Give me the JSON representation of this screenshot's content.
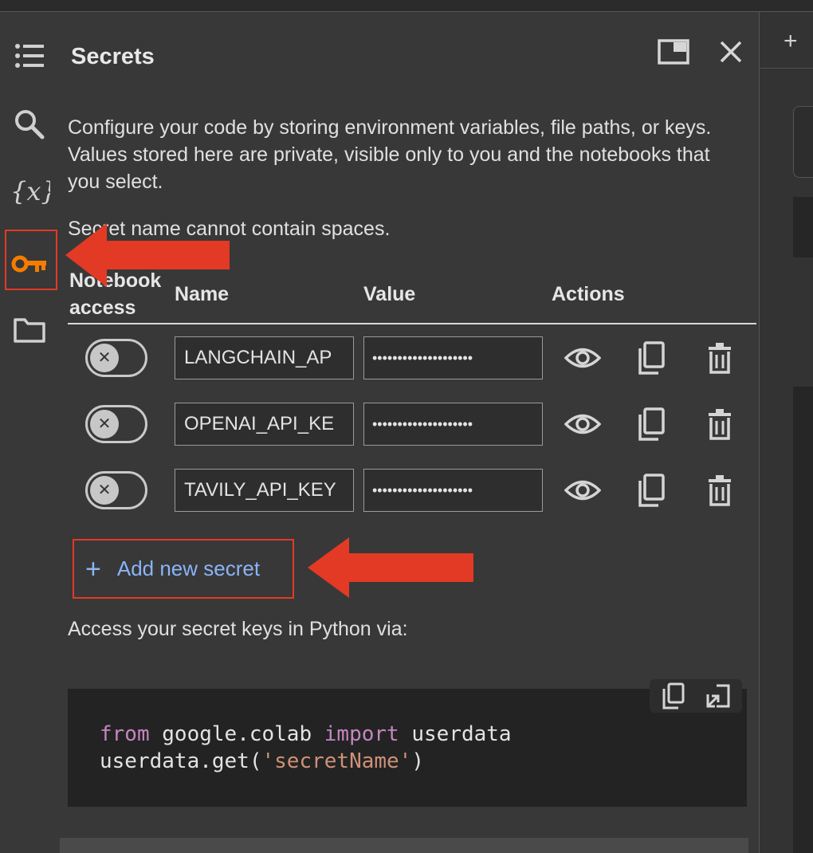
{
  "panel": {
    "title": "Secrets",
    "description": "Configure your code by storing environment variables, file paths, or keys. Values stored here are private, visible only to you and the notebooks that you select.",
    "name_note": "Secret name cannot contain spaces.",
    "columns": {
      "access_line1": "Notebook",
      "access_line2": "access",
      "name": "Name",
      "value": "Value",
      "actions": "Actions"
    },
    "secrets": [
      {
        "name": "LANGCHAIN_AP",
        "value": "••••••••••••••••••••",
        "notebook_access": false
      },
      {
        "name": "OPENAI_API_KE",
        "value": "••••••••••••••••••••",
        "notebook_access": false
      },
      {
        "name": "TAVILY_API_KEY",
        "value": "••••••••••••••••••••",
        "notebook_access": false
      }
    ],
    "add_label": "Add new secret",
    "access_text": "Access your secret keys in Python via:",
    "code": {
      "line1_kw1": "from",
      "line1_mod": " google.colab ",
      "line1_kw2": "import",
      "line1_rest": " userdata",
      "line2_pre": "userdata.get(",
      "line2_str": "'secretName'",
      "line2_post": ")"
    }
  },
  "rail": {
    "items": [
      "toc-icon",
      "search-icon",
      "variables-icon",
      "key-icon",
      "folder-icon"
    ],
    "active": "key-icon"
  },
  "colors": {
    "background": "#383838",
    "accent_link": "#8ab4f8",
    "active_icon": "#f57c00",
    "annotation_red": "#e23a25"
  }
}
